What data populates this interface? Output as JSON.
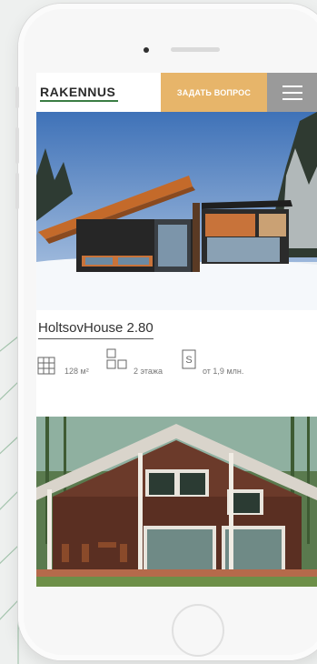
{
  "header": {
    "logo": "RAKENNUS",
    "ask_button": "ЗАДАТЬ ВОПРОС",
    "menu_icon": "hamburger-menu-icon"
  },
  "listings": [
    {
      "title": "HoltsovHouse 2.80",
      "area": "128 м²",
      "floors": "2 этажа",
      "price": "от 1,9 млн."
    }
  ],
  "colors": {
    "accent": "#e7b56a",
    "menu_bg": "#9a9a9a",
    "logo_green": "#3a7d44"
  }
}
